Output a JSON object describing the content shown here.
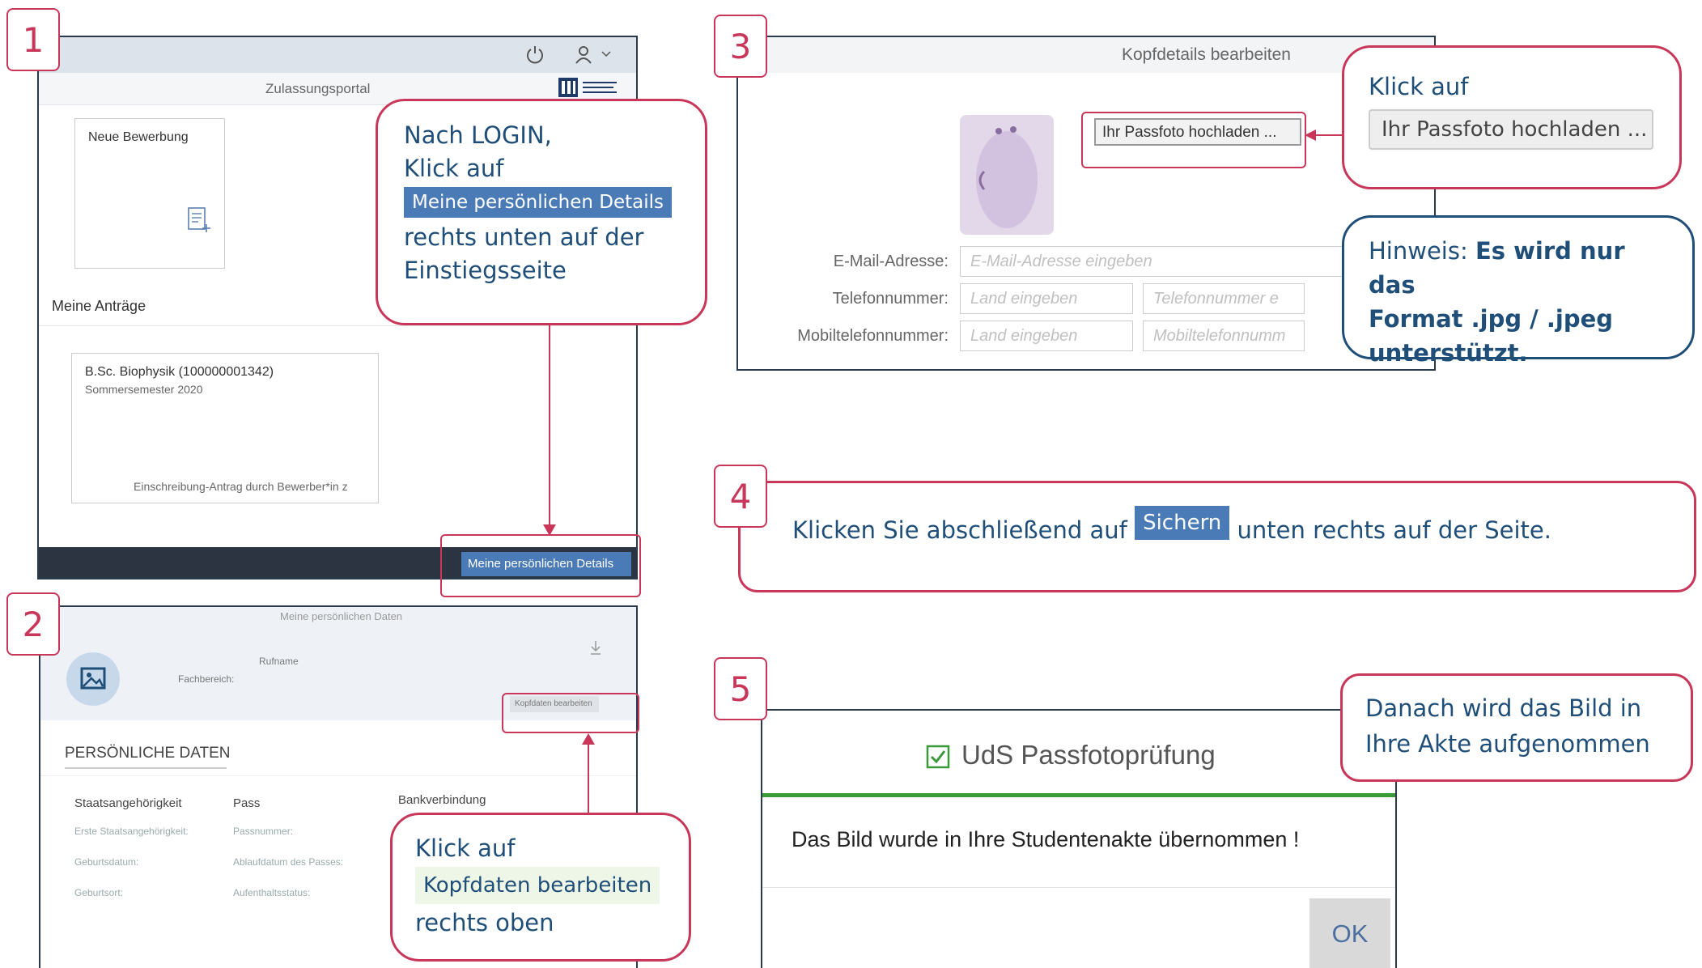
{
  "colors": {
    "accent": "#c8375a",
    "blue_text": "#1f4e79",
    "highlight_bg": "#4a7bb7",
    "success_green": "#3a9a3a",
    "dark_bar": "#2b3440"
  },
  "step1": {
    "number": "1",
    "portal_title": "Zulassungsportal",
    "new_application": "Neue Bewerbung",
    "my_applications": "Meine Anträge",
    "application_title": "B.Sc. Biophysik (100000001342)",
    "application_semester": "Sommersemester 2020",
    "application_status": "Einschreibung-Antrag durch Bewerber*in z",
    "details_button": "Meine persönlichen Details",
    "callout_line1": "Nach LOGIN,",
    "callout_line2": "Klick auf",
    "callout_highlight": "Meine persönlichen Details",
    "callout_line3": "rechts unten auf der",
    "callout_line4": "Einstiegsseite",
    "icons": [
      "power-icon",
      "user-icon",
      "chevron-down-icon",
      "university-logo",
      "new-document-icon"
    ]
  },
  "step2": {
    "number": "2",
    "header": "Meine persönlichen Daten",
    "rufname_label": "Rufname",
    "fachbereich_label": "Fachbereich:",
    "edit_button": "Kopfdaten bearbeiten",
    "section_title": "PERSÖNLICHE DATEN",
    "col1_header": "Staatsangehörigkeit",
    "col1_rows": [
      "Erste Staatsangehörigkeit:",
      "Geburtsdatum:",
      "Geburtsort:"
    ],
    "col2_header": "Pass",
    "col2_rows": [
      "Passnummer:",
      "Ablaufdatum des Passes:",
      "Aufenthaltsstatus:"
    ],
    "col3_header": "Bankverbindung",
    "callout_line1": "Klick auf",
    "callout_highlight": "Kopfdaten bearbeiten",
    "callout_line2": "rechts oben"
  },
  "step3": {
    "number": "3",
    "dialog_title": "Kopfdetails bearbeiten",
    "upload_button": "Ihr Passfoto hochladen ...",
    "email_label": "E-Mail-Adresse:",
    "email_placeholder": "E-Mail-Adresse eingeben",
    "phone_label": "Telefonnummer:",
    "phone_country_placeholder": "Land eingeben",
    "phone_placeholder": "Telefonnummer e",
    "mobile_label": "Mobiltelefonnummer:",
    "mobile_country_placeholder": "Land eingeben",
    "mobile_placeholder": "Mobiltelefonnumm",
    "callout_line1": "Klick auf",
    "callout_button": "Ihr Passfoto hochladen ...",
    "hint_prefix": "Hinweis: ",
    "hint_bold1": "Es wird nur das",
    "hint_bold2": "Format .jpg / .jpeg",
    "hint_bold3": "unterstützt."
  },
  "step4": {
    "number": "4",
    "text_before": "Klicken Sie abschließend auf",
    "save_button": "Sichern",
    "text_after": "unten rechts auf der Seite."
  },
  "step5": {
    "number": "5",
    "dialog_title": "UdS Passfotoprüfung",
    "message": "Das Bild wurde in Ihre Studentenakte übernommen !",
    "ok_button": "OK",
    "callout_line1": "Danach wird das Bild in",
    "callout_line2": "Ihre Akte aufgenommen"
  }
}
